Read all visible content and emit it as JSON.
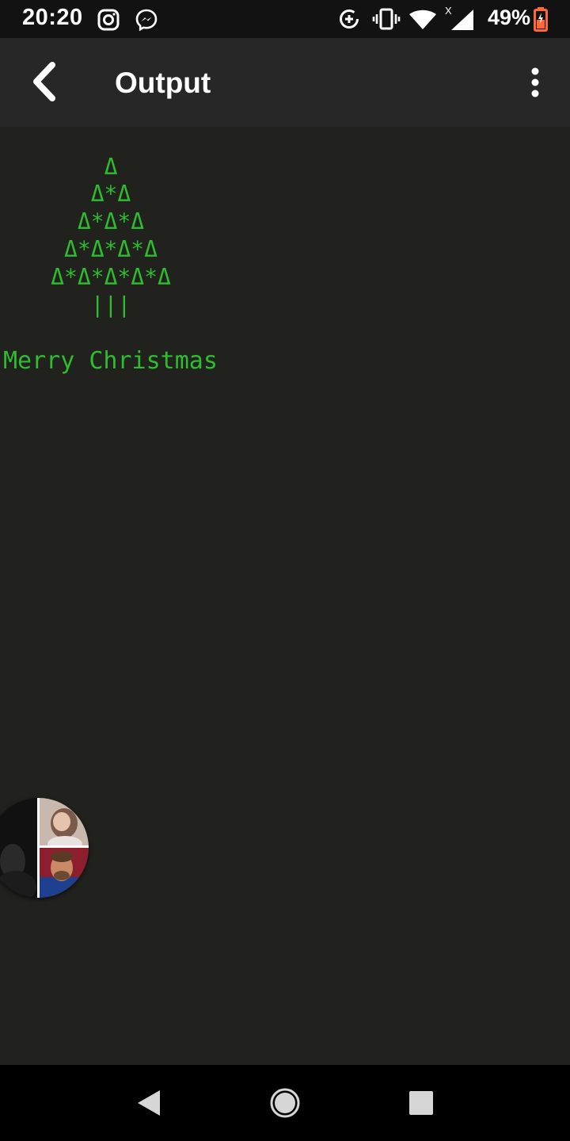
{
  "status_bar": {
    "time": "20:20",
    "left_icons": [
      "instagram-icon",
      "messenger-icon"
    ],
    "right_icons": [
      "data-saver-icon",
      "vibrate-icon",
      "wifi-icon",
      "signal-icon",
      "battery-icon"
    ],
    "battery_percent": "49%",
    "signal_mark": "X"
  },
  "app_bar": {
    "title": "Output",
    "back_icon": "chevron-left-icon",
    "menu_icon": "more-vertical-icon"
  },
  "console": {
    "color": "#2ebd2e",
    "tree_lines": [
      "Δ",
      "Δ*Δ",
      "Δ*Δ*Δ",
      "Δ*Δ*Δ*Δ",
      "Δ*Δ*Δ*Δ*Δ",
      "|||"
    ],
    "message": "Merry Christmas"
  },
  "chat_head": {
    "icon": "chat-heads-avatar-group"
  },
  "nav_bar": {
    "buttons": [
      "back-triangle-icon",
      "home-circle-icon",
      "recents-square-icon"
    ]
  }
}
